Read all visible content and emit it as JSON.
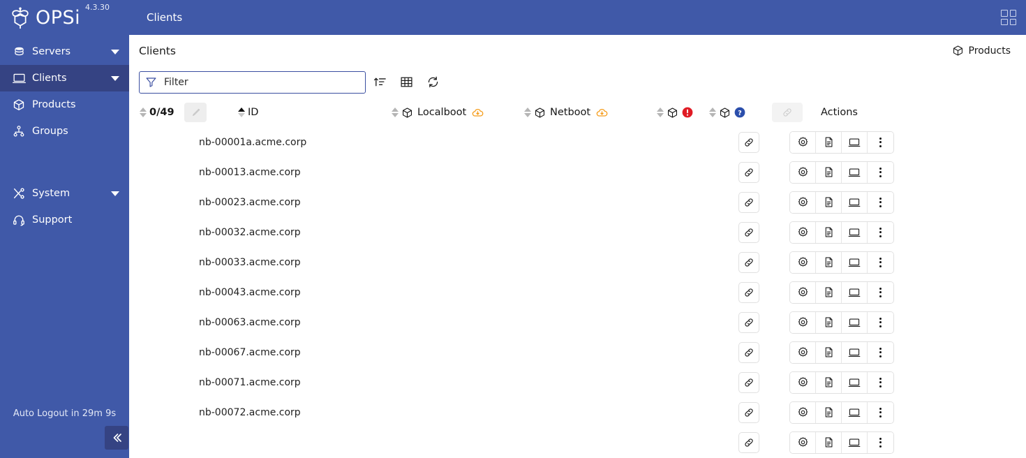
{
  "app": {
    "brand_name": "OPSi",
    "version": "4.3.30",
    "topbar_title": "Clients",
    "apps_menu_icon": "apps-grid-icon",
    "logo_icon": "opsi-bee-logo-icon",
    "colors": {
      "brand_blue": "#4059a8",
      "active_nav": "#354383",
      "accent_orange": "#f59c1a",
      "badge_red": "#e01b24",
      "badge_blue": "#2b4eab",
      "filter_border": "#3a4ea0"
    }
  },
  "sidebar": {
    "items": [
      {
        "label": "Servers",
        "icon": "database-icon",
        "caret": true,
        "active": false
      },
      {
        "label": "Clients",
        "icon": "monitor-icon",
        "caret": true,
        "active": true
      },
      {
        "label": "Products",
        "icon": "package-icon",
        "caret": false,
        "active": false
      },
      {
        "label": "Groups",
        "icon": "sitemap-icon",
        "caret": false,
        "active": false
      },
      {
        "label": "System",
        "icon": "tools-icon",
        "caret": true,
        "active": false
      },
      {
        "label": "Support",
        "icon": "headset-icon",
        "caret": false,
        "active": false
      }
    ],
    "auto_logout": "Auto Logout in 29m 9s",
    "collapse_icon": "chevron-double-left-icon"
  },
  "page": {
    "title": "Clients",
    "products_button": {
      "label": "Products",
      "icon": "package-icon"
    }
  },
  "toolbar": {
    "filter": {
      "placeholder": "Filter",
      "value": "",
      "icon": "filter-funnel-icon"
    },
    "buttons": [
      {
        "name": "sort-button",
        "icon": "sort-ascending-icon"
      },
      {
        "name": "columns-button",
        "icon": "table-grid-icon"
      },
      {
        "name": "refresh-button",
        "icon": "refresh-icon"
      }
    ]
  },
  "table": {
    "selection_count": "0/49",
    "edit_icon": "brush-pencil-icon",
    "columns": [
      {
        "key": "id",
        "label": "ID",
        "sort": "asc",
        "icon": null
      },
      {
        "key": "localboot",
        "label": "Localboot",
        "sort": "none",
        "icon": "package-icon",
        "badge": "cloud-download-icon"
      },
      {
        "key": "netboot",
        "label": "Netboot",
        "sort": "none",
        "icon": "package-icon",
        "badge": "cloud-download-icon"
      },
      {
        "key": "failed",
        "label": "",
        "sort": "none",
        "icon": "package-icon",
        "badge": "error-exclamation-icon"
      },
      {
        "key": "unknown",
        "label": "",
        "sort": "none",
        "icon": "package-icon",
        "badge": "unknown-question-icon"
      }
    ],
    "link_column_icon": "link-chain-icon",
    "actions_label": "Actions",
    "row_actions": [
      {
        "name": "settings-action",
        "icon": "gear-icon"
      },
      {
        "name": "log-action",
        "icon": "document-icon"
      },
      {
        "name": "terminal-action",
        "icon": "monitor-icon"
      },
      {
        "name": "more-action",
        "icon": "kebab-menu-icon"
      }
    ],
    "rows": [
      {
        "id": "nb-00001a.acme.corp",
        "localboot": "",
        "netboot": "",
        "failed": "",
        "unknown": ""
      },
      {
        "id": "nb-00013.acme.corp",
        "localboot": "",
        "netboot": "",
        "failed": "",
        "unknown": ""
      },
      {
        "id": "nb-00023.acme.corp",
        "localboot": "",
        "netboot": "",
        "failed": "",
        "unknown": ""
      },
      {
        "id": "nb-00032.acme.corp",
        "localboot": "",
        "netboot": "",
        "failed": "",
        "unknown": ""
      },
      {
        "id": "nb-00033.acme.corp",
        "localboot": "",
        "netboot": "",
        "failed": "",
        "unknown": ""
      },
      {
        "id": "nb-00043.acme.corp",
        "localboot": "",
        "netboot": "",
        "failed": "",
        "unknown": ""
      },
      {
        "id": "nb-00063.acme.corp",
        "localboot": "",
        "netboot": "",
        "failed": "",
        "unknown": ""
      },
      {
        "id": "nb-00067.acme.corp",
        "localboot": "",
        "netboot": "",
        "failed": "",
        "unknown": ""
      },
      {
        "id": "nb-00071.acme.corp",
        "localboot": "",
        "netboot": "",
        "failed": "",
        "unknown": ""
      },
      {
        "id": "nb-00072.acme.corp",
        "localboot": "",
        "netboot": "",
        "failed": "",
        "unknown": ""
      },
      {
        "id": "",
        "localboot": "",
        "netboot": "",
        "failed": "",
        "unknown": ""
      }
    ]
  }
}
